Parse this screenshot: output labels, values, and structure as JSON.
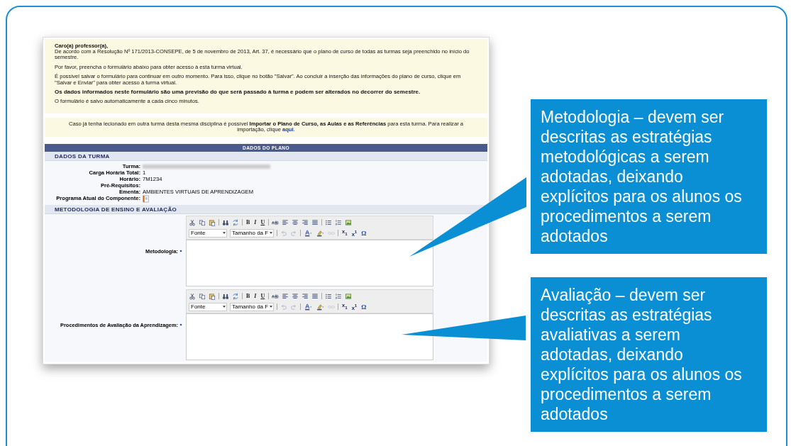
{
  "notice": {
    "greeting": "Caro(a) professor(a),",
    "paragraphs": [
      {
        "kind": "normal",
        "text": "De acordo com a Resolução Nº 171/2013-CONSEPE, de 5 de novembro de 2013, Art. 37, é necessário que o plano de curso de todas as turmas seja preenchido no início do semestre."
      },
      {
        "kind": "normal",
        "text": "Por favor, preencha o formulário abaixo para obter acesso à esta turma virtual."
      },
      {
        "kind": "normal",
        "text": "É possível salvar o formulário para continuar em outro momento. Para isso, clique no botão \"Salvar\". Ao concluir a inserção das informações do plano de curso, clique em \"Salvar e Enviar\" para obter acesso à turma virtual."
      },
      {
        "kind": "bold",
        "text": "Os dados informados neste formulário são uma previsão do que será passado à turma e podem ser alterados no decorrer do semestre."
      },
      {
        "kind": "normal",
        "text": "O formulário é salvo automaticamente a cada cinco minutos."
      }
    ]
  },
  "import_notice": {
    "text": "Caso já tenha lecionado em outra turma desta mesma disciplina é possível **Importar o Plano de Curso, as Aulas e as Referências** para esta turma. Para realizar a importação, clique",
    "link": "aqui",
    "after": "."
  },
  "panel": {
    "title": "DADOS DO PLANO",
    "section": "DADOS DA TURMA",
    "fields": [
      {
        "label": "Turma:",
        "kind": "blurred"
      },
      {
        "label": "Carga Horária Total:",
        "kind": "text",
        "value": "1"
      },
      {
        "label": "Horário:",
        "kind": "text",
        "value": "7M1234"
      },
      {
        "label": "Pré-Requisitos:",
        "kind": "text"
      },
      {
        "label": "Ementa:",
        "kind": "text",
        "value": "AMBIENTES VIRTUAIS DE APRENDIZAGEM"
      },
      {
        "label": "Programa Atual do Componente:",
        "kind": "icon"
      }
    ],
    "section_2": "METODOLOGIA DE ENSINO E AVALIAÇÃO",
    "editors": [
      {
        "label": "Metodologia:",
        "required": true,
        "font_select": "Fonte",
        "size_select": "Tamanho da F",
        "format_buttons": [
          "B",
          "I",
          "U"
        ],
        "script_buttons": [
          "x$_{1}$",
          "x$^{1}$"
        ],
        "symbol": "Ω"
      },
      {
        "label": "Procedimentos de Avaliação da Aprendizagem:",
        "required": true,
        "font_select": "Fonte",
        "size_select": "Tamanho da F",
        "format_buttons": [
          "B",
          "I",
          "U"
        ],
        "script_buttons": [
          "x$_{1}$",
          "x$^{1}$"
        ],
        "symbol": "Ω"
      }
    ]
  },
  "callouts": [
    {
      "text": "Metodologia – devem ser descritas as estratégias metodológicas a serem adotadas, deixando explícitos para os alunos os procedimentos a serem adotados"
    },
    {
      "text": "Avaliação – devem ser descritas as estratégias avaliativas a serem adotadas, deixando explícitos para os alunos os procedimentos a serem adotados"
    }
  ]
}
